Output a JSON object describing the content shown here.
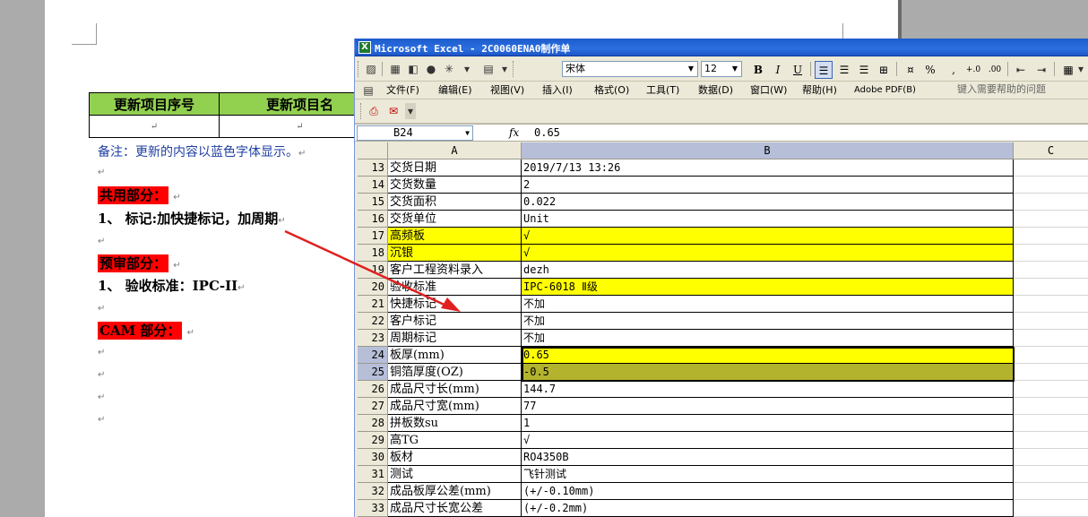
{
  "word": {
    "table": {
      "headers": [
        "更新项目序号",
        "更新项目名"
      ],
      "empty_cell_mark": "↵"
    },
    "note": "备注：更新的内容以蓝色字体显示。",
    "para_mark": "↵",
    "sections": [
      {
        "title": "共用部分：",
        "trail": "↵"
      },
      {
        "title": "预审部分：",
        "trail": "↵"
      },
      {
        "title": "CAM 部分：",
        "trail": "↵"
      }
    ],
    "lines": [
      "1、 标记:加快捷标记，加周期",
      "1、 验收标准：IPC-II"
    ]
  },
  "excel": {
    "title": "Microsoft Excel - 2C0060ENA0制作单",
    "app_icon": "excel-icon",
    "font_name": "宋体",
    "font_size": "12",
    "toolbar_labels": {
      "bold": "B",
      "italic": "I",
      "underline": "U",
      "percent": "%",
      "comma": ",",
      "inc_decimal": "+.0\n.00",
      "dec_decimal": ".00\n→.0"
    },
    "menu": [
      "文件(F)",
      "编辑(E)",
      "视图(V)",
      "插入(I)",
      "格式(O)",
      "工具(T)",
      "数据(D)",
      "窗口(W)",
      "帮助(H)",
      "Adobe PDF(B)"
    ],
    "help_placeholder": "键入需要帮助的问题",
    "name_box": "B24",
    "fx": "fx",
    "formula": "0.65",
    "columns": [
      "A",
      "B",
      "C"
    ],
    "rows": [
      {
        "n": "13",
        "a": "交货日期",
        "b": "2019/7/13 13:26",
        "hl": ""
      },
      {
        "n": "14",
        "a": "交货数量",
        "b": "2",
        "hl": ""
      },
      {
        "n": "15",
        "a": "交货面积",
        "b": "0.022",
        "hl": ""
      },
      {
        "n": "16",
        "a": "交货单位",
        "b": "Unit",
        "hl": ""
      },
      {
        "n": "17",
        "a": "高频板",
        "b": "√",
        "hl": "yellow-ab"
      },
      {
        "n": "18",
        "a": "沉银",
        "b": "√",
        "hl": "yellow-ab"
      },
      {
        "n": "19",
        "a": "客户工程资料录入",
        "b": "dezh",
        "hl": ""
      },
      {
        "n": "20",
        "a": "验收标准",
        "b": "IPC-6018 Ⅱ级",
        "hl": "yellow-b"
      },
      {
        "n": "21",
        "a": "快捷标记",
        "b": "不加",
        "hl": ""
      },
      {
        "n": "22",
        "a": "客户标记",
        "b": "不加",
        "hl": ""
      },
      {
        "n": "23",
        "a": "周期标记",
        "b": "不加",
        "hl": ""
      },
      {
        "n": "24",
        "a": "板厚(mm)",
        "b": "0.65",
        "hl": "yellow-b"
      },
      {
        "n": "25",
        "a": "铜箔厚度(OZ)",
        "b": "-0.5",
        "hl": "olive-b"
      },
      {
        "n": "26",
        "a": "成品尺寸长(mm)",
        "b": "144.7",
        "hl": ""
      },
      {
        "n": "27",
        "a": "成品尺寸宽(mm)",
        "b": "77",
        "hl": ""
      },
      {
        "n": "28",
        "a": "拼板数su",
        "b": "1",
        "hl": ""
      },
      {
        "n": "29",
        "a": "高TG",
        "b": "√",
        "hl": ""
      },
      {
        "n": "30",
        "a": "板材",
        "b": "RO4350B",
        "hl": ""
      },
      {
        "n": "31",
        "a": "测试",
        "b": "飞针测试",
        "hl": ""
      },
      {
        "n": "32",
        "a": "成品板厚公差(mm)",
        "b": "(+/-0.10mm)",
        "hl": ""
      },
      {
        "n": "33",
        "a": "成品尺寸长宽公差",
        "b": "(+/-0.2mm)",
        "hl": ""
      }
    ],
    "colors": {
      "highlight": "#ffff00",
      "olive": "#b3b32d",
      "arrow": "#e02020"
    }
  }
}
